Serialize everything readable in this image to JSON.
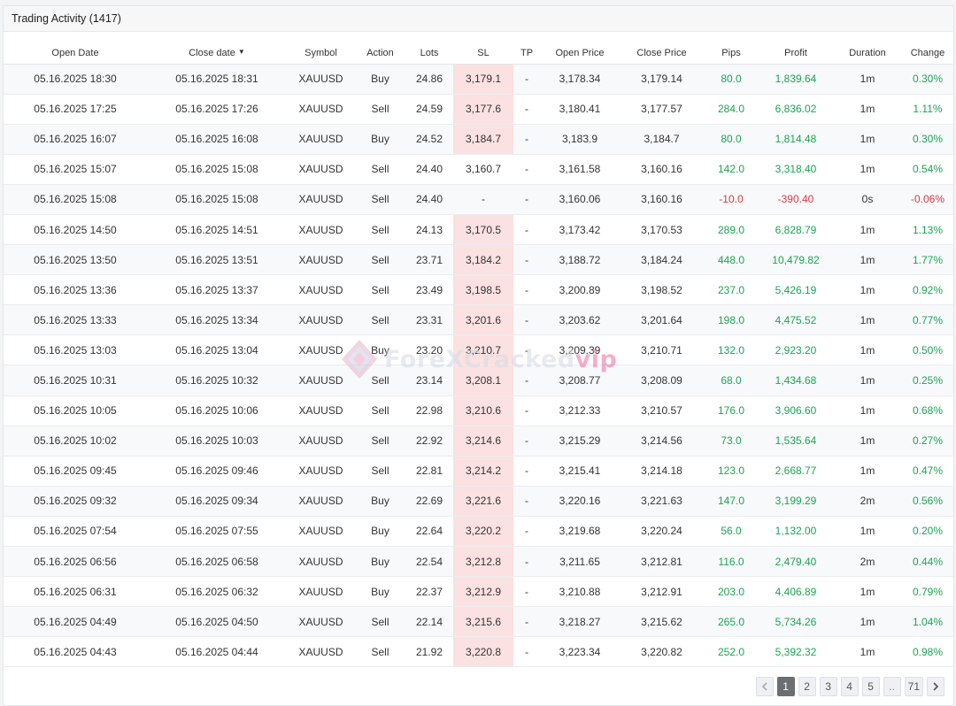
{
  "panel": {
    "title": "Trading Activity (1417)"
  },
  "columns": [
    {
      "key": "open_date",
      "label": "Open Date"
    },
    {
      "key": "close_date",
      "label": "Close date",
      "sorted": true
    },
    {
      "key": "symbol",
      "label": "Symbol"
    },
    {
      "key": "action",
      "label": "Action"
    },
    {
      "key": "lots",
      "label": "Lots"
    },
    {
      "key": "sl",
      "label": "SL"
    },
    {
      "key": "tp",
      "label": "TP"
    },
    {
      "key": "open_price",
      "label": "Open Price"
    },
    {
      "key": "close_price",
      "label": "Close Price"
    },
    {
      "key": "pips",
      "label": "Pips"
    },
    {
      "key": "profit",
      "label": "Profit"
    },
    {
      "key": "duration",
      "label": "Duration"
    },
    {
      "key": "change",
      "label": "Change"
    }
  ],
  "sort_icon": "caret-down-icon",
  "rows": [
    {
      "open_date": "05.16.2025 18:30",
      "close_date": "05.16.2025 18:31",
      "symbol": "XAUUSD",
      "action": "Buy",
      "lots": "24.86",
      "sl": "3,179.1",
      "tp": "-",
      "open_price": "3,178.34",
      "close_price": "3,179.14",
      "pips": "80.0",
      "profit": "1,839.64",
      "duration": "1m",
      "change": "0.30%",
      "sl_hit": true,
      "positive": true
    },
    {
      "open_date": "05.16.2025 17:25",
      "close_date": "05.16.2025 17:26",
      "symbol": "XAUUSD",
      "action": "Sell",
      "lots": "24.59",
      "sl": "3,177.6",
      "tp": "-",
      "open_price": "3,180.41",
      "close_price": "3,177.57",
      "pips": "284.0",
      "profit": "6,836.02",
      "duration": "1m",
      "change": "1.11%",
      "sl_hit": true,
      "positive": true
    },
    {
      "open_date": "05.16.2025 16:07",
      "close_date": "05.16.2025 16:08",
      "symbol": "XAUUSD",
      "action": "Buy",
      "lots": "24.52",
      "sl": "3,184.7",
      "tp": "-",
      "open_price": "3,183.9",
      "close_price": "3,184.7",
      "pips": "80.0",
      "profit": "1,814.48",
      "duration": "1m",
      "change": "0.30%",
      "sl_hit": true,
      "positive": true
    },
    {
      "open_date": "05.16.2025 15:07",
      "close_date": "05.16.2025 15:08",
      "symbol": "XAUUSD",
      "action": "Sell",
      "lots": "24.40",
      "sl": "3,160.7",
      "tp": "-",
      "open_price": "3,161.58",
      "close_price": "3,160.16",
      "pips": "142.0",
      "profit": "3,318.40",
      "duration": "1m",
      "change": "0.54%",
      "sl_hit": false,
      "positive": true
    },
    {
      "open_date": "05.16.2025 15:08",
      "close_date": "05.16.2025 15:08",
      "symbol": "XAUUSD",
      "action": "Sell",
      "lots": "24.40",
      "sl": "-",
      "tp": "-",
      "open_price": "3,160.06",
      "close_price": "3,160.16",
      "pips": "-10.0",
      "profit": "-390.40",
      "duration": "0s",
      "change": "-0.06%",
      "sl_hit": false,
      "positive": false
    },
    {
      "open_date": "05.16.2025 14:50",
      "close_date": "05.16.2025 14:51",
      "symbol": "XAUUSD",
      "action": "Sell",
      "lots": "24.13",
      "sl": "3,170.5",
      "tp": "-",
      "open_price": "3,173.42",
      "close_price": "3,170.53",
      "pips": "289.0",
      "profit": "6,828.79",
      "duration": "1m",
      "change": "1.13%",
      "sl_hit": true,
      "positive": true
    },
    {
      "open_date": "05.16.2025 13:50",
      "close_date": "05.16.2025 13:51",
      "symbol": "XAUUSD",
      "action": "Sell",
      "lots": "23.71",
      "sl": "3,184.2",
      "tp": "-",
      "open_price": "3,188.72",
      "close_price": "3,184.24",
      "pips": "448.0",
      "profit": "10,479.82",
      "duration": "1m",
      "change": "1.77%",
      "sl_hit": true,
      "positive": true
    },
    {
      "open_date": "05.16.2025 13:36",
      "close_date": "05.16.2025 13:37",
      "symbol": "XAUUSD",
      "action": "Sell",
      "lots": "23.49",
      "sl": "3,198.5",
      "tp": "-",
      "open_price": "3,200.89",
      "close_price": "3,198.52",
      "pips": "237.0",
      "profit": "5,426.19",
      "duration": "1m",
      "change": "0.92%",
      "sl_hit": true,
      "positive": true
    },
    {
      "open_date": "05.16.2025 13:33",
      "close_date": "05.16.2025 13:34",
      "symbol": "XAUUSD",
      "action": "Sell",
      "lots": "23.31",
      "sl": "3,201.6",
      "tp": "-",
      "open_price": "3,203.62",
      "close_price": "3,201.64",
      "pips": "198.0",
      "profit": "4,475.52",
      "duration": "1m",
      "change": "0.77%",
      "sl_hit": true,
      "positive": true
    },
    {
      "open_date": "05.16.2025 13:03",
      "close_date": "05.16.2025 13:04",
      "symbol": "XAUUSD",
      "action": "Buy",
      "lots": "23.20",
      "sl": "3,210.7",
      "tp": "-",
      "open_price": "3,209.39",
      "close_price": "3,210.71",
      "pips": "132.0",
      "profit": "2,923.20",
      "duration": "1m",
      "change": "0.50%",
      "sl_hit": true,
      "positive": true
    },
    {
      "open_date": "05.16.2025 10:31",
      "close_date": "05.16.2025 10:32",
      "symbol": "XAUUSD",
      "action": "Sell",
      "lots": "23.14",
      "sl": "3,208.1",
      "tp": "-",
      "open_price": "3,208.77",
      "close_price": "3,208.09",
      "pips": "68.0",
      "profit": "1,434.68",
      "duration": "1m",
      "change": "0.25%",
      "sl_hit": true,
      "positive": true
    },
    {
      "open_date": "05.16.2025 10:05",
      "close_date": "05.16.2025 10:06",
      "symbol": "XAUUSD",
      "action": "Sell",
      "lots": "22.98",
      "sl": "3,210.6",
      "tp": "-",
      "open_price": "3,212.33",
      "close_price": "3,210.57",
      "pips": "176.0",
      "profit": "3,906.60",
      "duration": "1m",
      "change": "0.68%",
      "sl_hit": true,
      "positive": true
    },
    {
      "open_date": "05.16.2025 10:02",
      "close_date": "05.16.2025 10:03",
      "symbol": "XAUUSD",
      "action": "Sell",
      "lots": "22.92",
      "sl": "3,214.6",
      "tp": "-",
      "open_price": "3,215.29",
      "close_price": "3,214.56",
      "pips": "73.0",
      "profit": "1,535.64",
      "duration": "1m",
      "change": "0.27%",
      "sl_hit": true,
      "positive": true
    },
    {
      "open_date": "05.16.2025 09:45",
      "close_date": "05.16.2025 09:46",
      "symbol": "XAUUSD",
      "action": "Sell",
      "lots": "22.81",
      "sl": "3,214.2",
      "tp": "-",
      "open_price": "3,215.41",
      "close_price": "3,214.18",
      "pips": "123.0",
      "profit": "2,668.77",
      "duration": "1m",
      "change": "0.47%",
      "sl_hit": true,
      "positive": true
    },
    {
      "open_date": "05.16.2025 09:32",
      "close_date": "05.16.2025 09:34",
      "symbol": "XAUUSD",
      "action": "Buy",
      "lots": "22.69",
      "sl": "3,221.6",
      "tp": "-",
      "open_price": "3,220.16",
      "close_price": "3,221.63",
      "pips": "147.0",
      "profit": "3,199.29",
      "duration": "2m",
      "change": "0.56%",
      "sl_hit": true,
      "positive": true
    },
    {
      "open_date": "05.16.2025 07:54",
      "close_date": "05.16.2025 07:55",
      "symbol": "XAUUSD",
      "action": "Buy",
      "lots": "22.64",
      "sl": "3,220.2",
      "tp": "-",
      "open_price": "3,219.68",
      "close_price": "3,220.24",
      "pips": "56.0",
      "profit": "1,132.00",
      "duration": "1m",
      "change": "0.20%",
      "sl_hit": true,
      "positive": true
    },
    {
      "open_date": "05.16.2025 06:56",
      "close_date": "05.16.2025 06:58",
      "symbol": "XAUUSD",
      "action": "Buy",
      "lots": "22.54",
      "sl": "3,212.8",
      "tp": "-",
      "open_price": "3,211.65",
      "close_price": "3,212.81",
      "pips": "116.0",
      "profit": "2,479.40",
      "duration": "2m",
      "change": "0.44%",
      "sl_hit": true,
      "positive": true
    },
    {
      "open_date": "05.16.2025 06:31",
      "close_date": "05.16.2025 06:32",
      "symbol": "XAUUSD",
      "action": "Buy",
      "lots": "22.37",
      "sl": "3,212.9",
      "tp": "-",
      "open_price": "3,210.88",
      "close_price": "3,212.91",
      "pips": "203.0",
      "profit": "4,406.89",
      "duration": "1m",
      "change": "0.79%",
      "sl_hit": true,
      "positive": true
    },
    {
      "open_date": "05.16.2025 04:49",
      "close_date": "05.16.2025 04:50",
      "symbol": "XAUUSD",
      "action": "Sell",
      "lots": "22.14",
      "sl": "3,215.6",
      "tp": "-",
      "open_price": "3,218.27",
      "close_price": "3,215.62",
      "pips": "265.0",
      "profit": "5,734.26",
      "duration": "1m",
      "change": "1.04%",
      "sl_hit": true,
      "positive": true
    },
    {
      "open_date": "05.16.2025 04:43",
      "close_date": "05.16.2025 04:44",
      "symbol": "XAUUSD",
      "action": "Sell",
      "lots": "21.92",
      "sl": "3,220.8",
      "tp": "-",
      "open_price": "3,223.34",
      "close_price": "3,220.82",
      "pips": "252.0",
      "profit": "5,392.32",
      "duration": "1m",
      "change": "0.98%",
      "sl_hit": true,
      "positive": true
    }
  ],
  "pagination": {
    "prev_icon": "chevron-left-icon",
    "next_icon": "chevron-right-icon",
    "pages": [
      "1",
      "2",
      "3",
      "4",
      "5",
      "..",
      "71"
    ],
    "current": "1"
  },
  "watermark": {
    "text_main": "ForeXCracked",
    "text_accent": "vip",
    "logo_icon": "diamond-logo-icon"
  },
  "colors": {
    "positive": "#1aa553",
    "negative": "#e0383e",
    "sl_highlight": "#fbe1e1"
  }
}
